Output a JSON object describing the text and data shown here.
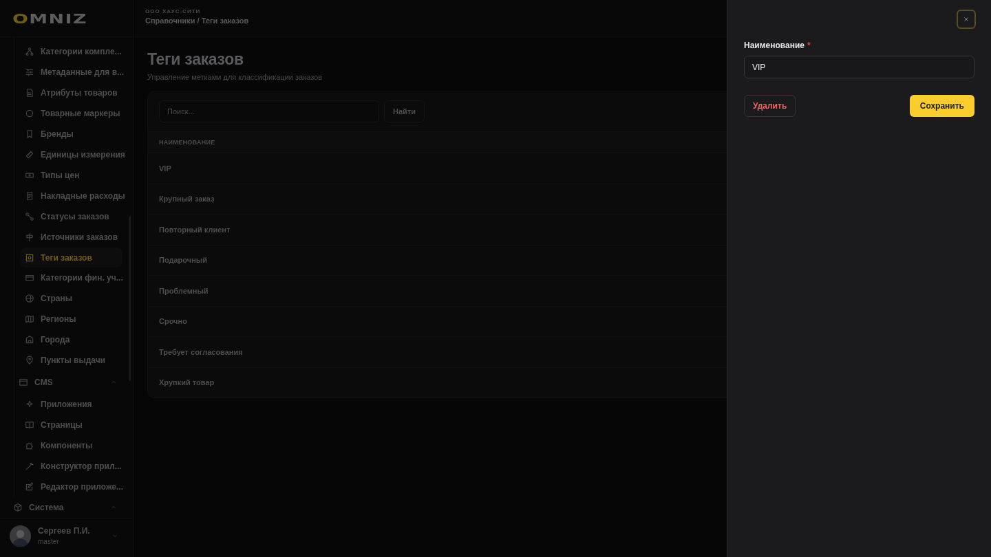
{
  "logo": "OMNIZ",
  "header": {
    "company": "ООО ХАУС-СИТИ",
    "breadcrumb": "Справочники / Теги заказов"
  },
  "sidebar": {
    "items": [
      {
        "kind": "link",
        "label": "Категории компле...",
        "selected": false
      },
      {
        "kind": "link",
        "label": "Метаданные для в...",
        "selected": false
      },
      {
        "kind": "link",
        "label": "Атрибуты товаров",
        "selected": false
      },
      {
        "kind": "link",
        "label": "Товарные маркеры",
        "selected": false
      },
      {
        "kind": "link",
        "label": "Бренды",
        "selected": false
      },
      {
        "kind": "link",
        "label": "Единицы измерения",
        "selected": false
      },
      {
        "kind": "link",
        "label": "Типы цен",
        "selected": false
      },
      {
        "kind": "link",
        "label": "Накладные расходы",
        "selected": false
      },
      {
        "kind": "link",
        "label": "Статусы заказов",
        "selected": false
      },
      {
        "kind": "link",
        "label": "Источники заказов",
        "selected": false
      },
      {
        "kind": "link",
        "label": "Теги заказов",
        "selected": true
      },
      {
        "kind": "link",
        "label": "Категории фин. уч...",
        "selected": false
      },
      {
        "kind": "link",
        "label": "Страны",
        "selected": false
      },
      {
        "kind": "link",
        "label": "Регионы",
        "selected": false
      },
      {
        "kind": "link",
        "label": "Города",
        "selected": false
      },
      {
        "kind": "link",
        "label": "Пункты выдачи",
        "selected": false
      },
      {
        "kind": "group",
        "label": "CMS",
        "expanded": true,
        "children": [
          {
            "label": "Приложения",
            "selected": false
          },
          {
            "label": "Страницы",
            "selected": false
          },
          {
            "label": "Компоненты",
            "selected": false
          },
          {
            "label": "Конструктор прил...",
            "selected": false
          },
          {
            "label": "Редактор приложе...",
            "selected": false
          }
        ]
      }
    ],
    "section": {
      "label": "Система",
      "expanded": true
    },
    "user": {
      "name": "Сергеев П.И.",
      "role": "master"
    }
  },
  "page": {
    "title": "Теги заказов",
    "subtitle": "Управление метками для классификации заказов"
  },
  "search": {
    "placeholder": "Поиск...",
    "button": "Найти"
  },
  "table": {
    "columns": [
      "НАИМЕНОВАНИЕ"
    ],
    "rows": [
      "VIP",
      "Крупный заказ",
      "Повторный клиент",
      "Подарочный",
      "Проблемный",
      "Срочно",
      "Требует согласования",
      "Хрупкий товар"
    ]
  },
  "drawer": {
    "field": {
      "label": "Наименование",
      "required_mark": "*",
      "value": "VIP"
    },
    "delete_button": "Удалить",
    "save_button": "Сохранить"
  }
}
